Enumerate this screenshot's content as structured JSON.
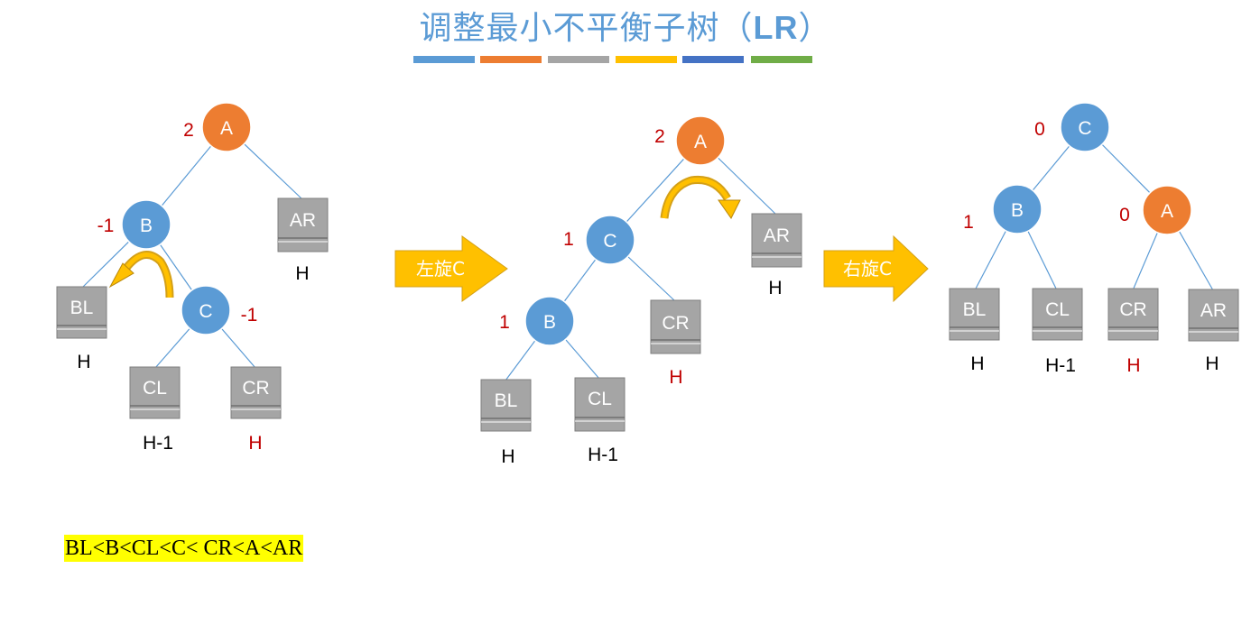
{
  "title": {
    "main": "调整最小不平衡子树（",
    "bold": "LR",
    "end": "）"
  },
  "colors": {
    "title": "#5b9bd5",
    "node_blue": "#5b9bd5",
    "node_orange": "#ed7d31",
    "subtree_gray": "#a5a5a5",
    "balance_red": "#c00000",
    "arrow_gold": "#ffc000",
    "curve_gold": "#d4a017",
    "highlight_yellow": "#ffff00",
    "strip": [
      "#5b9bd5",
      "#ed7d31",
      "#a5a5a5",
      "#ffc000",
      "#4472c4",
      "#70ad47"
    ]
  },
  "diagram1": {
    "nodes": {
      "A": "A",
      "B": "B",
      "C": "C"
    },
    "balance": {
      "A": "2",
      "B": "-1",
      "C": "-1"
    },
    "subtrees": {
      "BL": "BL",
      "CL": "CL",
      "CR": "CR",
      "AR": "AR"
    },
    "heights": {
      "BL": "H",
      "CL": "H-1",
      "CR": "H",
      "AR": "H"
    }
  },
  "step1": {
    "label": "左旋C"
  },
  "diagram2": {
    "nodes": {
      "A": "A",
      "C": "C",
      "B": "B"
    },
    "balance": {
      "A": "2",
      "C": "1",
      "B": "1"
    },
    "subtrees": {
      "BL": "BL",
      "CL": "CL",
      "CR": "CR",
      "AR": "AR"
    },
    "heights": {
      "BL": "H",
      "CL": "H-1",
      "CR": "H",
      "AR": "H"
    }
  },
  "step2": {
    "label": "右旋C"
  },
  "diagram3": {
    "nodes": {
      "C": "C",
      "B": "B",
      "A": "A"
    },
    "balance": {
      "C": "0",
      "B": "1",
      "A": "0"
    },
    "subtrees": {
      "BL": "BL",
      "CL": "CL",
      "CR": "CR",
      "AR": "AR"
    },
    "heights": {
      "BL": "H",
      "CL": "H-1",
      "CR": "H",
      "AR": "H"
    }
  },
  "order": "BL<B<CL<C< CR<A<AR"
}
